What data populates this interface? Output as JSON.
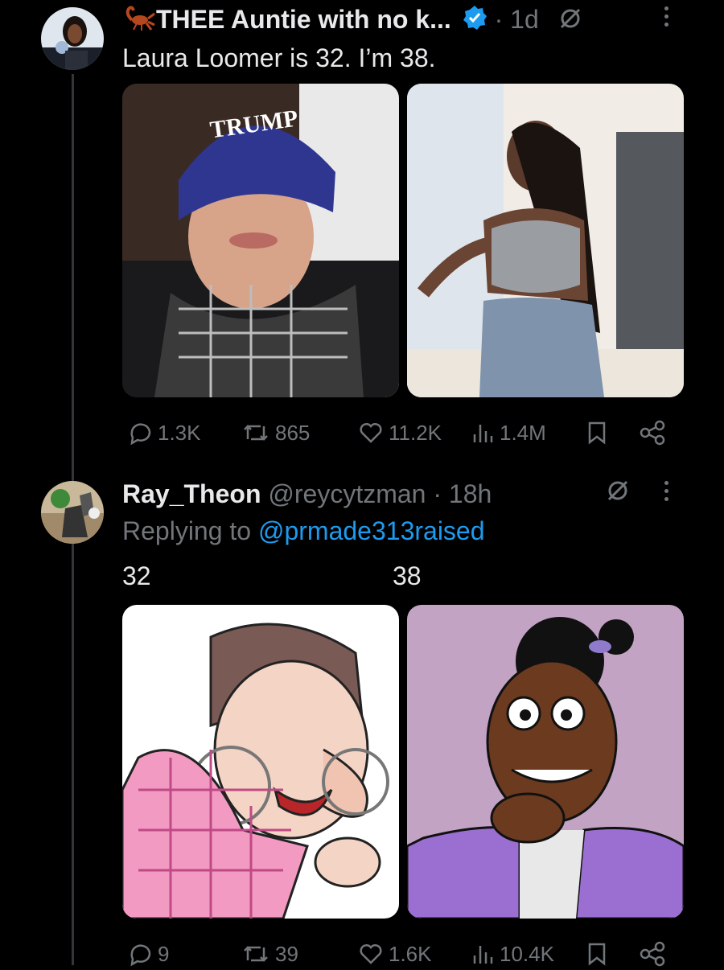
{
  "tweet1": {
    "display_name": "THEE Auntie with no k...",
    "name_emoji": "scorpion",
    "verified_icon": "verified-badge-icon",
    "time": "· 1d",
    "text": "Laura Loomer is 32. I’m 38.",
    "stats": {
      "replies": "1.3K",
      "reposts": "865",
      "likes": "11.2K",
      "views": "1.4M"
    }
  },
  "tweet2": {
    "display_name": "Ray_Theon",
    "handle": "@reycytzman",
    "time": "· 18h",
    "replying_prefix": "Replying to",
    "replying_to": "@prmade313raised",
    "label_left": "32",
    "label_right": "38",
    "stats": {
      "replies": "9",
      "reposts": "39",
      "likes": "1.6K",
      "views": "10.4K"
    }
  },
  "colors": {
    "background": "#000000",
    "text": "#e7e9ea",
    "muted": "#71767b",
    "link": "#1d9bf0",
    "verified": "#1d9bf0"
  }
}
